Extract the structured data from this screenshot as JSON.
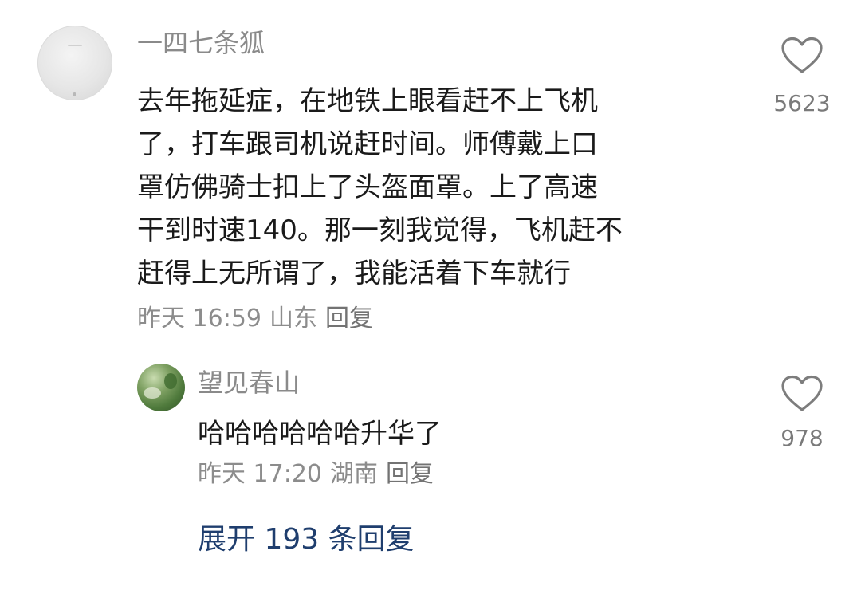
{
  "comment": {
    "username": "一四七条狐",
    "lines": [
      "去年拖延症，在地铁上眼看赶不上飞机",
      "了，打车跟司机说赶时间。师傅戴上口",
      "罩仿佛骑士扣上了头盔面罩。上了高速",
      "干到时速140。那一刻我觉得，飞机赶不",
      "赶得上无所谓了，我能活着下车就行"
    ],
    "time": "昨天 16:59",
    "location": "山东",
    "reply_label": "回复",
    "like_icon": "heart-outline-icon",
    "like_count": "5623"
  },
  "reply": {
    "username": "望见春山",
    "text": "哈哈哈哈哈哈升华了",
    "time": "昨天 17:20",
    "location": "湖南",
    "reply_label": "回复",
    "like_icon": "heart-outline-icon",
    "like_count": "978"
  },
  "expand_label": "展开 193 条回复",
  "colors": {
    "text": "#1a1a1a",
    "muted": "#8a8a8a",
    "link": "#1f3e6e",
    "background": "#ffffff"
  }
}
